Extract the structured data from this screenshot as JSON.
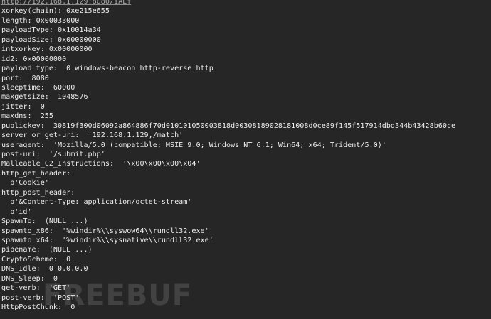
{
  "terminal": {
    "lines": [
      {
        "text": "http://192.168.1.129:8080/iALf",
        "kind": "url"
      },
      {
        "text": "xorkey(chain): 0xe215e655"
      },
      {
        "text": "length: 0x00033000"
      },
      {
        "text": "payloadType: 0x10014a34"
      },
      {
        "text": "payloadSize: 0x00000000"
      },
      {
        "text": "intxorkey: 0x00000000"
      },
      {
        "text": "id2: 0x00000000"
      },
      {
        "text": "payload type:  0 windows-beacon_http-reverse_http"
      },
      {
        "text": "port:  8080"
      },
      {
        "text": "sleeptime:  60000"
      },
      {
        "text": "maxgetsize:  1048576"
      },
      {
        "text": "jitter:  0"
      },
      {
        "text": "maxdns:  255"
      },
      {
        "text": "publickey:  30819f300d06092a864886f70d010101050003818d00308189028181008d0ce89f145f517914dbd344b43428b60ce"
      },
      {
        "text": "server_or_get-uri:  '192.168.1.129,/match'"
      },
      {
        "text": "useragent:  'Mozilla/5.0 (compatible; MSIE 9.0; Windows NT 6.1; Win64; x64; Trident/5.0)'"
      },
      {
        "text": "post-uri:  '/submit.php'"
      },
      {
        "text": "Malleable_C2_Instructions:  '\\x00\\x00\\x00\\x04'"
      },
      {
        "text": "http_get_header:"
      },
      {
        "text": "  b'Cookie'"
      },
      {
        "text": "http_post_header:"
      },
      {
        "text": "  b'&Content-Type: application/octet-stream'"
      },
      {
        "text": "  b'id'"
      },
      {
        "text": "SpawnTo:  (NULL ...)"
      },
      {
        "text": "spawnto_x86:  '%windir%\\\\syswow64\\\\rundll32.exe'"
      },
      {
        "text": "spawnto_x64:  '%windir%\\\\sysnative\\\\rundll32.exe'"
      },
      {
        "text": "pipename:  (NULL ...)"
      },
      {
        "text": "CryptoScheme:  0"
      },
      {
        "text": "DNS_Idle:  0 0.0.0.0"
      },
      {
        "text": "DNS_Sleep:  0"
      },
      {
        "text": "get-verb:  'GET'"
      },
      {
        "text": "post-verb:  'POST'"
      },
      {
        "text": "HttpPostChunk:  0"
      }
    ]
  },
  "watermark": {
    "text": "FREEBUF"
  },
  "colors": {
    "background": "#262626",
    "text": "#ececec",
    "url": "#a9a9a9"
  }
}
